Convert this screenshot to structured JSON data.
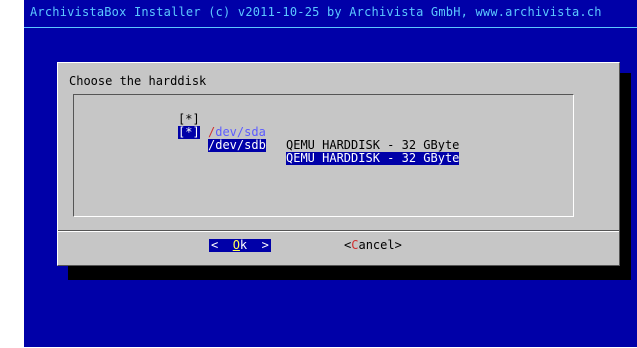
{
  "backtitle": "ArchivistaBox Installer (c) v2011-10-25 by Archivista GmbH, www.archivista.ch",
  "dialog": {
    "title": "Choose the harddisk",
    "items": [
      {
        "checkbox": "[*]",
        "slash": "/",
        "device": "dev/sda",
        "description": "QEMU HARDDISK - 32 GByte",
        "selected": false
      },
      {
        "checkbox": "[*]",
        "slash": "/",
        "device": "dev/sdb",
        "description": "QEMU HARDDISK - 32 GByte",
        "selected": true
      }
    ],
    "buttons": {
      "ok": {
        "left": "<  ",
        "hot": "O",
        "rest": "k",
        "right": "  >"
      },
      "cancel": {
        "left": "<",
        "hot": "C",
        "rest": "ancel",
        "right": ">"
      }
    }
  },
  "colors": {
    "background": "#0000a8",
    "dialog": "#c6c6c6",
    "highlight": "#0000a8",
    "backtitle": "#5cc8ff",
    "hotkey": "#d03030"
  }
}
